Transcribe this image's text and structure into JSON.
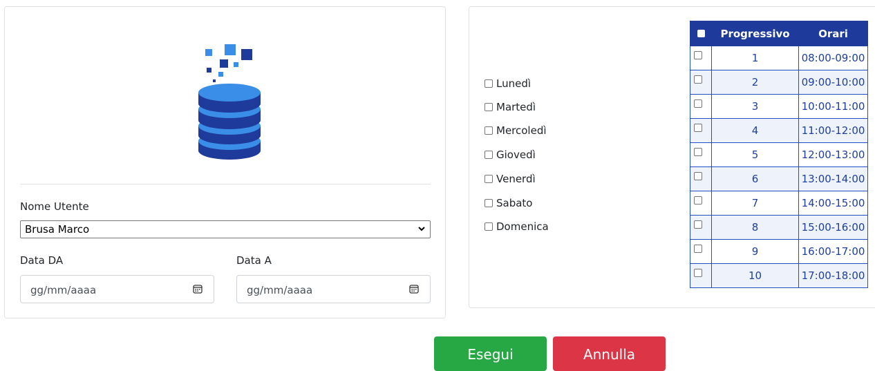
{
  "form": {
    "user_label": "Nome Utente",
    "user_value": "Brusa Marco",
    "date_from_label": "Data DA",
    "date_to_label": "Data A",
    "date_placeholder": "gg/mm/aaaa"
  },
  "days": [
    "Lunedì",
    "Martedì",
    "Mercoledì",
    "Giovedì",
    "Venerdì",
    "Sabato",
    "Domenica"
  ],
  "table": {
    "headers": [
      "Progressivo",
      "Orari"
    ],
    "rows": [
      {
        "n": "1",
        "time": "08:00-09:00"
      },
      {
        "n": "2",
        "time": "09:00-10:00"
      },
      {
        "n": "3",
        "time": "10:00-11:00"
      },
      {
        "n": "4",
        "time": "11:00-12:00"
      },
      {
        "n": "5",
        "time": "12:00-13:00"
      },
      {
        "n": "6",
        "time": "13:00-14:00"
      },
      {
        "n": "7",
        "time": "14:00-15:00"
      },
      {
        "n": "8",
        "time": "15:00-16:00"
      },
      {
        "n": "9",
        "time": "16:00-17:00"
      },
      {
        "n": "10",
        "time": "17:00-18:00"
      }
    ]
  },
  "buttons": {
    "run": "Esegui",
    "cancel": "Annulla"
  },
  "colors": {
    "primary_blue": "#1e3a9a",
    "light_blue": "#3b8ee8",
    "success": "#28a745",
    "danger": "#dc3545"
  }
}
